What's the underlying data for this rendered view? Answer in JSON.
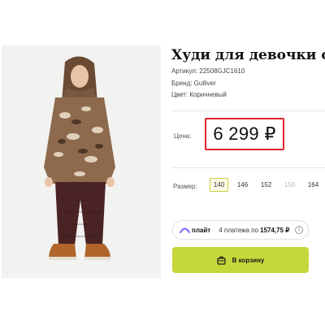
{
  "product": {
    "title": "Худи для девочки ове",
    "sku": "Артикул: 22508GJC1610",
    "brand": "Бренд: Gulliver",
    "color": "Цвет: Коричневый"
  },
  "price": {
    "label": "Цена:",
    "value": "6 299 ₽",
    "highlight_color": "#e3242b"
  },
  "sizes": {
    "label": "Размер:",
    "options": [
      {
        "value": "140",
        "state": "selected"
      },
      {
        "value": "146",
        "state": "available"
      },
      {
        "value": "152",
        "state": "available"
      },
      {
        "value": "158",
        "state": "unavailable"
      },
      {
        "value": "164",
        "state": "available"
      }
    ]
  },
  "plait": {
    "brand": "плайт",
    "text": "4 платежа по",
    "amount": "1574,75 ₽",
    "info_icon": "info-icon"
  },
  "cart": {
    "label": "В корзину",
    "icon": "bag-icon",
    "accent": "#c5d83a"
  }
}
